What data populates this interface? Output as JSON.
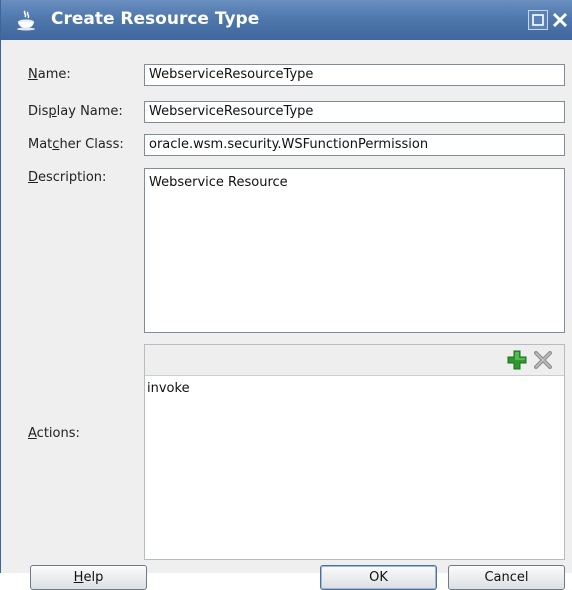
{
  "window": {
    "title": "Create Resource Type"
  },
  "form": {
    "name_label_prefix": "",
    "name_label_mnemonic": "N",
    "name_label_rest": "ame:",
    "name_value": "WebserviceResourceType",
    "display_label_prefix": "Dis",
    "display_label_mnemonic": "p",
    "display_label_rest": "lay Name:",
    "display_value": "WebserviceResourceType",
    "matcher_label_prefix": "Mat",
    "matcher_label_mnemonic": "c",
    "matcher_label_rest": "her Class:",
    "matcher_value": "oracle.wsm.security.WSFunctionPermission",
    "description_label_prefix": "",
    "description_label_mnemonic": "D",
    "description_label_rest": "escription:",
    "description_value": "Webservice Resource",
    "actions_label_prefix": "",
    "actions_label_mnemonic": "A",
    "actions_label_rest": "ctions:",
    "actions": [
      "invoke"
    ]
  },
  "buttons": {
    "help_mnemonic": "H",
    "help_rest": "elp",
    "ok": "OK",
    "cancel": "Cancel"
  },
  "icons": {
    "title": "coffee-cup-icon",
    "maximize": "maximize-icon",
    "close": "close-icon",
    "add": "add-icon",
    "remove": "remove-icon"
  },
  "colors": {
    "titlebar": "#4f78ad",
    "add_icon": "#2e9a2e",
    "remove_icon": "#9a9a9a"
  }
}
